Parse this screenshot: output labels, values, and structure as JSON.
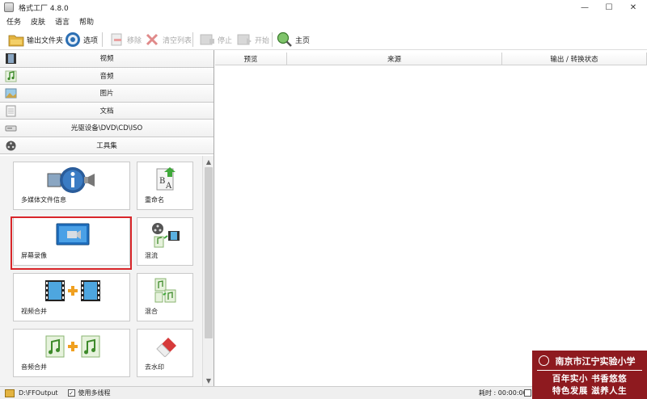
{
  "window": {
    "title": "格式工厂 4.8.0",
    "minimize": "—",
    "maximize": "☐",
    "close": "✕"
  },
  "menu": [
    "任务",
    "皮肤",
    "语言",
    "帮助"
  ],
  "toolbar": {
    "output_folder": "输出文件夹",
    "options": "选项",
    "remove": "移除",
    "clear_list": "清空列表",
    "stop": "停止",
    "start": "开始",
    "home": "主页"
  },
  "categories": [
    {
      "label": "视频",
      "icon": "film-icon"
    },
    {
      "label": "音频",
      "icon": "music-note-icon"
    },
    {
      "label": "图片",
      "icon": "picture-icon"
    },
    {
      "label": "文档",
      "icon": "document-icon"
    },
    {
      "label": "光驱设备\\DVD\\CD\\ISO",
      "icon": "disc-drive-icon"
    },
    {
      "label": "工具集",
      "icon": "tools-reel-icon"
    }
  ],
  "tools": {
    "media_info": "多媒体文件信息",
    "rename": "重命名",
    "screen_record": "屏幕录像",
    "mux": "混流",
    "video_join": "视频合并",
    "mix": "混合",
    "audio_join": "音频合并",
    "remove_watermark": "去水印"
  },
  "table": {
    "columns": [
      "预览",
      "来源",
      "输出 / 转换状态"
    ]
  },
  "status": {
    "output_path": "D:\\FFOutput",
    "multithread_label": "使用多线程",
    "multithread_checked": true,
    "elapsed": "耗时 : 00:00:00"
  },
  "watermark": {
    "school": "南京市江宁实验小学",
    "line1": "百年实小  书香悠悠",
    "line2": "特色发展  滋养人生"
  }
}
